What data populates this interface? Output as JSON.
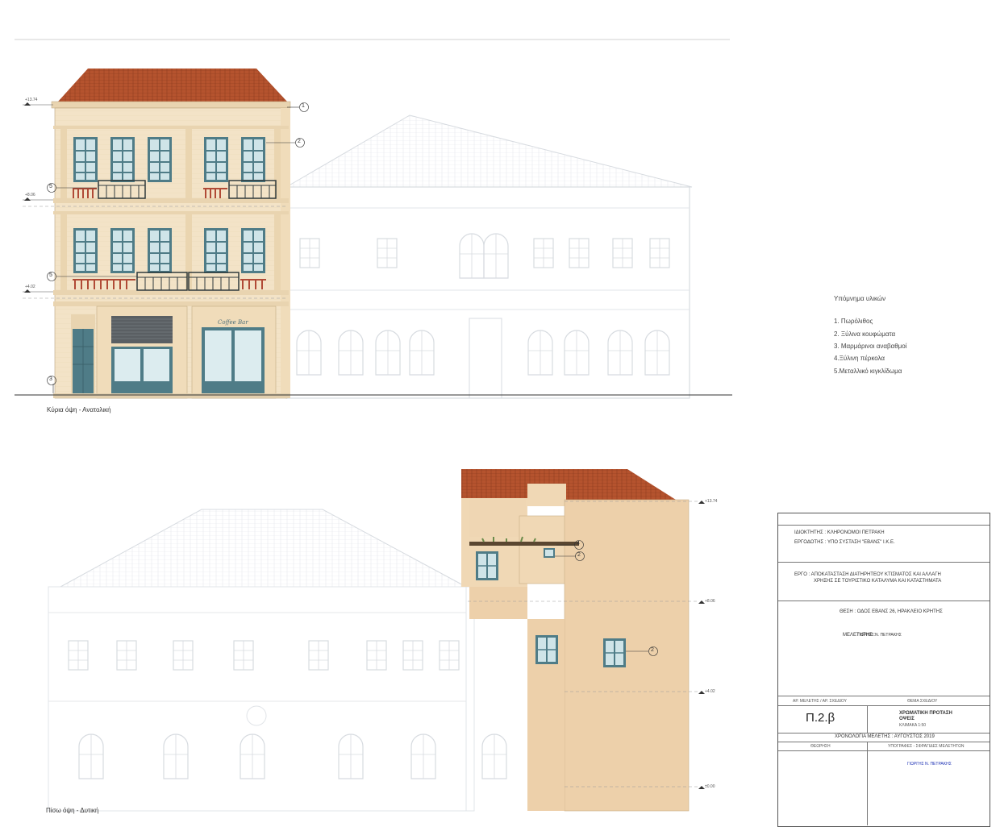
{
  "elevations": {
    "front_label": "Κύρια όψη - Ανατολική",
    "rear_label": "Πίσω όψη - Δυτική",
    "shop_sign": "Coffee Bar",
    "level_front_top": "+13.74",
    "level_front_mid1": "+8.06",
    "level_front_mid2": "+4.02",
    "level_rear_top": "+13.74",
    "level_rear_mid1": "+8.06",
    "level_rear_mid2": "+4.02",
    "level_rear_ground": "±0.00",
    "callouts_front": [
      "1",
      "2",
      "5",
      "5",
      "3"
    ],
    "callouts_rear": [
      "4",
      "2",
      "2"
    ]
  },
  "legend": {
    "title": "Υπόμνημα υλικών",
    "items": [
      "1. Πωρόλιθος",
      "2. Ξύλινα κουφώματα",
      "3. Μαρμάρινοι αναβαθμοί",
      "4.Ξύλινη πέρκολα",
      "5.Μεταλλικό κιγκλίδωμα"
    ]
  },
  "title_block": {
    "owner": "ΙΔΙΟΚΤΗΤΗΣ : ΚΛΗΡΟΝΟΜΟΙ ΠΕΤΡΑΚΗ",
    "client": "ΕΡΓΟΔΟΤΗΣ : ΥΠΟ ΣΥΣΤΑΣΗ \"ΕΒΑΝΣ\" Ι.Κ.Ε.",
    "project_line1": "ΕΡΓΟ : ΑΠΟΚΑΤΑΣΤΑΣΗ ΔΙΑΤΗΡΗΤΕΟΥ ΚΤΙΣΜΑΤΟΣ ΚΑΙ ΑΛΛΑΓΗ",
    "project_line2": "ΧΡΗΣΗΣ ΣΕ ΤΟΥΡΙΣΤΙΚΟ ΚΑΤΑΛΥΜΑ ΚΑΙ ΚΑΤΑΣΤΗΜΑΤΑ",
    "location": "ΘΕΣΗ : ΟΔΟΣ ΕΒΑΝΣ 26, ΗΡΑΚΛΕΙΟ ΚΡΗΤΗΣ",
    "designer_label": "ΜΕΛΕΤΗΤΗΣ :",
    "designer_name": "ΓΙΩΡΓΗΣ Ν. ΠΕΤΡΑΚΗΣ",
    "study_number_header": "ΑΡ. ΜΕΛΕΤΗΣ / ΑΡ. ΣΧΕΔΙΟΥ",
    "drawing_subject_header": "ΘΕΜΑ ΣΧΕΔΙΟΥ",
    "drawing_code": "Π.2.β",
    "drawing_title_line1": "ΧΡΩΜΑΤΙΚΗ ΠΡΟΤΑΣΗ",
    "drawing_title_line2": "ΟΨΕΙΣ",
    "scale": "ΚΛΙΜΑΚΑ 1:50",
    "study_date": "ΧΡΟΝΟΛΟΓΙΑ ΜΕΛΕΤΗΣ : ΑΥΓΟΥΣΤΟΣ 2019",
    "review_header": "ΘΕΩΡΗΣΗ",
    "signatures_header": "ΥΠΟΓΡΑΦΕΣ - ΣΦΡΑΓΙΔΕΣ ΜΕΛΕΤΗΤΩΝ",
    "stamp_name": "ΓΙΩΡΓΗΣ Ν. ΠΕΤΡΑΚΗΣ"
  },
  "colors": {
    "facade": "#f3e3c7",
    "facade_shade": "#e9d4b0",
    "roof": "#b5532e",
    "roof_dark": "#8a3a1e",
    "window": "#4f7c87",
    "glass": "#cfe4e8",
    "railing_red": "#b04a36",
    "rear_wall": "#edd0aa",
    "ghost": "#d7dbe0",
    "signature_ink": "#1b2fb4"
  }
}
